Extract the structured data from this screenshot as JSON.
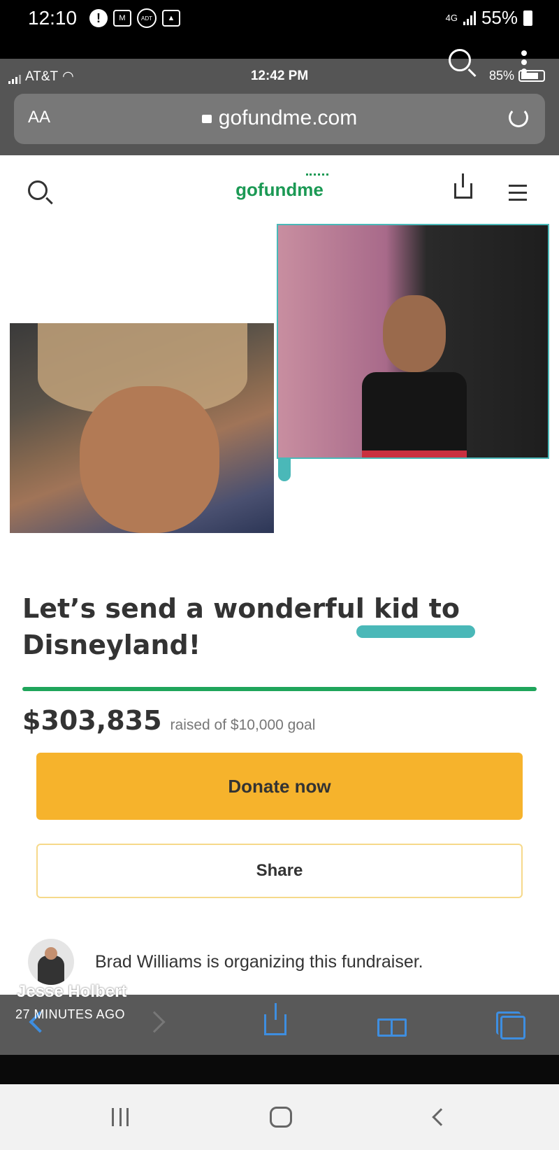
{
  "android_status": {
    "time": "12:10",
    "network": "4G",
    "battery": "55%"
  },
  "ios_status": {
    "carrier": "AT&T",
    "time": "12:42 PM",
    "battery": "85%"
  },
  "safari": {
    "aa_label": "AA",
    "domain": "gofundme.com"
  },
  "site": {
    "logo_text": "gofundme"
  },
  "campaign": {
    "title": "Let’s send a wonderful kid to Disneyland!",
    "raised": "$303,835",
    "goal_text": "raised of $10,000 goal",
    "progress_fraction": 1.0,
    "donate_label": "Donate now",
    "share_label": "Share",
    "organizer_text": "Brad Williams is organizing this fundraiser."
  },
  "story_overlay": {
    "poster": "Jesse Holbert",
    "posted": "27 MINUTES AGO"
  },
  "colors": {
    "brand_green": "#1b9954",
    "donate_yellow": "#f6b32c",
    "ios_blue": "#3e8ee0",
    "photo_border_teal": "#4ab8b8"
  }
}
